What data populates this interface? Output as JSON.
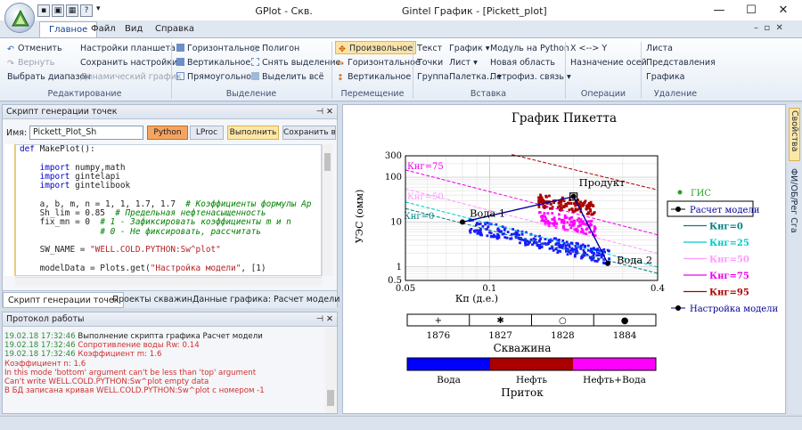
{
  "app": {
    "title": "GPlot - Скв.",
    "doc_title": "Gintel График - [Pickett_plot]"
  },
  "tabs": [
    "Главное",
    "Файл",
    "Вид",
    "Справка"
  ],
  "ribbon": {
    "edit": {
      "label": "Редактирование",
      "undo": "Отменить",
      "redo": "Вернуть",
      "select_range": "Выбрать диапазон",
      "tablet_settings": "Настройки планшета",
      "save_settings": "Сохранить настройки",
      "dynamic_graph": "Динамический график"
    },
    "selection": {
      "label": "Выделение",
      "horizontal": "Горизонтальное",
      "vertical": "Вертикальное",
      "rect": "Прямоугольное",
      "polygon": "Полигон",
      "deselect": "Снять выделение",
      "select_all": "Выделить всё"
    },
    "move": {
      "label": "Перемещение",
      "free": "Произвольное",
      "horizontal": "Горизонтальное",
      "vertical": "Вертикальное"
    },
    "insert": {
      "label": "Вставка",
      "text": "Текст",
      "points": "Точки",
      "group": "Группа",
      "graph": "График",
      "sheet": "Лист",
      "palette": "Палетка...",
      "python_module": "Модуль на Python",
      "new_area": "Новая область",
      "petrophys": "Петрофиз. связь"
    },
    "ops": {
      "label": "Операции",
      "swap": "X <--> Y",
      "axis_assign": "Назначение осей"
    },
    "delete": {
      "label": "Удаление",
      "sheet": "Листа",
      "view": "Представления",
      "graph": "Графика"
    }
  },
  "script_panel": {
    "title": "Скрипт генерации точек",
    "name_label": "Имя:",
    "name_value": "Pickett_Plot_Sh",
    "btn_python": "Python",
    "btn_lproc": "LProc",
    "btn_run": "Выполнить",
    "btn_save": "Сохранить в б"
  },
  "code": [
    "def MakePlot():",
    "",
    "    import numpy,math",
    "    import gintelapi",
    "    import gintelibook",
    "",
    "    a, b, m, n = 1, 1, 1.7, 1.7  # Коэффициенты формулы Ар",
    "    Sh_lim = 0.85  # Предельная нефтенасыщенность",
    "    fix_mn = 0  # 1 - Зафиксировать коэффициенты m и n",
    "                # 0 - Не фиксировать, рассчитать",
    "",
    "    SW_NAME = \"WELL.COLD.PYTHON:Sw^plot\"",
    "",
    "    modelData = Plots.get(\"Настройка модели\", [1)"
  ],
  "bottom_tabs": [
    "Скрипт генерации точек",
    "Проекты скважин",
    "Данные графика: Расчет модели (Кнг..."
  ],
  "log": {
    "title": "Протокол работы",
    "lines": [
      {
        "time": "19.02.18 17:32:46",
        "text": "Выполнение скрипта графика Расчет модели",
        "color": "#1e1e1e"
      },
      {
        "time": "19.02.18 17:32:46",
        "text": "Сопротивление воды Rw: 0.14",
        "color": "#d03030"
      },
      {
        "time": "19.02.18 17:32:46",
        "text": "Коэффициент m: 1.6",
        "color": "#d03030"
      },
      {
        "time": "",
        "text": "Коэффициент n: 1.6",
        "color": "#d03030"
      },
      {
        "time": "",
        "text": "In this mode 'bottom' argument can't be less than 'top' argument",
        "color": "#d03030"
      },
      {
        "time": "",
        "text": "Can't write WELL.COLD.PYTHON:Sw^plot empty data",
        "color": "#d03030"
      },
      {
        "time": "",
        "text": "В БД записана кривая WELL.COLD.PYTHON:Sw^plot с номером -1",
        "color": "#d03030"
      }
    ]
  },
  "side_tabs": [
    "Свойства",
    "ФИ/ОБ/Рег Сга"
  ],
  "chart_data": {
    "type": "scatter",
    "title": "График Пикетта",
    "xlabel": "Кп (д.е.)",
    "ylabel": "УЭС (омм)",
    "xscale": "log",
    "yscale": "log",
    "xlim": [
      0.05,
      0.4
    ],
    "ylim": [
      0.5,
      300
    ],
    "xticks": [
      "0.05",
      "0.1",
      "0.4"
    ],
    "yticks": [
      "0.5",
      "1",
      "10",
      "100",
      "300"
    ],
    "series": [
      {
        "name": "ГИС",
        "color": "#2ca02c"
      },
      {
        "name": "Расчет модели",
        "color": "#000000"
      },
      {
        "name": "Кнг=0",
        "color": "#008080"
      },
      {
        "name": "Кнг=25",
        "color": "#00cccc"
      },
      {
        "name": "Кнг=50",
        "color": "#ff99ff"
      },
      {
        "name": "Кнг=75",
        "color": "#ee00ee"
      },
      {
        "name": "Кнг=95",
        "color": "#aa0000"
      },
      {
        "name": "Настройка модели",
        "color": "#000099"
      }
    ],
    "lines": [
      {
        "label": "Кнг=95",
        "color": "#aa0000",
        "x": [
          0.12,
          0.4
        ],
        "y": [
          320,
          52
        ]
      },
      {
        "label": "Кнг=75",
        "color": "#ee00ee",
        "x": [
          0.05,
          0.4
        ],
        "y": [
          145,
          5.2
        ]
      },
      {
        "label": "Кнг=50",
        "color": "#ff99ff",
        "x": [
          0.05,
          0.4
        ],
        "y": [
          55,
          2
        ]
      },
      {
        "label": "Кнг=25",
        "color": "#00cccc",
        "x": [
          0.05,
          0.4
        ],
        "y": [
          28,
          1
        ]
      },
      {
        "label": "Кнг=0",
        "color": "#008080",
        "x": [
          0.05,
          0.4
        ],
        "y": [
          20,
          0.72
        ]
      }
    ],
    "model_line": {
      "color": "#000099",
      "x": [
        0.08,
        0.265
      ],
      "y": [
        10,
        1.2
      ]
    },
    "model_points": [
      {
        "label": "Вода 1",
        "x": 0.08,
        "y": 10
      },
      {
        "label": "Продукт",
        "x": 0.2,
        "y": 37
      },
      {
        "label": "Вода 2",
        "x": 0.265,
        "y": 1.2
      }
    ],
    "clusters": [
      {
        "color": "#1a1aff",
        "n": 260,
        "x": [
          0.085,
          0.27
        ],
        "y0": [
          8.5,
          1.6
        ],
        "spread": 0.16
      },
      {
        "color": "#ff00ff",
        "n": 110,
        "x": [
          0.15,
          0.24
        ],
        "y0": [
          13,
          7
        ],
        "spread": 0.16
      },
      {
        "color": "#aa0000",
        "n": 140,
        "x": [
          0.15,
          0.24
        ],
        "y0": [
          30,
          20
        ],
        "spread": 0.15
      }
    ],
    "wells": [
      {
        "symbol": "+",
        "name": "1876"
      },
      {
        "symbol": "✱",
        "name": "1827"
      },
      {
        "symbol": "○",
        "name": "1828"
      },
      {
        "symbol": "●",
        "name": "1884"
      }
    ],
    "wells_title": "Скважина",
    "inflow_title": "Приток",
    "inflow": [
      {
        "name": "Вода",
        "color": "#0000ff"
      },
      {
        "name": "Нефть",
        "color": "#aa0000"
      },
      {
        "name": "Нефть+Вода",
        "color": "#ff00ff"
      }
    ]
  }
}
